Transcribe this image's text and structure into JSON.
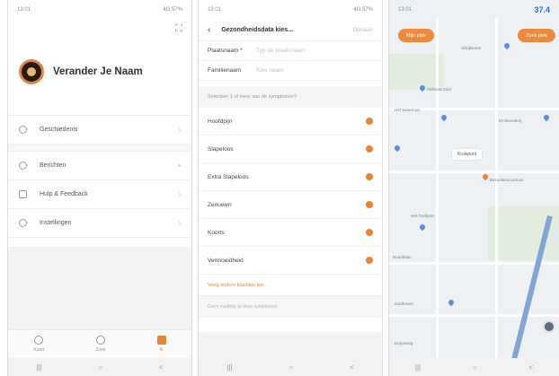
{
  "colors": {
    "accent": "#e8833a",
    "map_blue": "#5b8fd9"
  },
  "screen1": {
    "status_left": "13:01",
    "status_right": "4G 57%",
    "close_icon": "expand-icon",
    "profile_name": "Verander Je Naam",
    "menu": [
      {
        "label": "Geschiedenis",
        "icon": "clock-icon"
      },
      {
        "label": "Berichten",
        "icon": "bell-icon",
        "badge": "•"
      },
      {
        "label": "Hulp & Feedback",
        "icon": "help-icon"
      },
      {
        "label": "Instellingen",
        "icon": "settings-icon"
      }
    ],
    "tabs": [
      {
        "label": "Kaart",
        "icon": "map-icon"
      },
      {
        "label": "Zoek",
        "icon": "search-icon"
      },
      {
        "label": "Ik",
        "icon": "profile-icon"
      }
    ],
    "nav": [
      "|||",
      "○",
      "<"
    ]
  },
  "screen2": {
    "status_left": "13:01",
    "status_right": "4G 57%",
    "title": "Gezondheidsdata kies...",
    "save": "Opslaan",
    "fields": [
      {
        "label": "Plaatsnaam *",
        "value": "Typ de plaatsnaam"
      },
      {
        "label": "Familienaam",
        "value": "Kies naam"
      }
    ],
    "question": "Selecteer 1 of meer van de symptomen?",
    "options": [
      "Hoofdpijn",
      "Slapeloos",
      "Extra Slapeloos",
      "Zenuwen",
      "Koorts",
      "Vermoeidheid"
    ],
    "add_link": "Voeg andere klachten toe",
    "note": "Geen melding op deze symptomen",
    "nav": [
      "|||",
      "○",
      "<"
    ]
  },
  "screen3": {
    "status_left": "13:01",
    "status_right": "37.4",
    "pill_left": "Mijn plek",
    "pill_right": "Zoek plek",
    "labels": [
      "Uitkijktoren",
      "Gebouw Zuid",
      "Het Waterhuis",
      "De Boerderij",
      "Kruispunt",
      "Bezoekerscentrum",
      "Het Paviljoen",
      "Noordlaan",
      "Zuidhaven",
      "Dorpsweg"
    ],
    "nav": [
      "|||",
      "○",
      "<"
    ]
  }
}
